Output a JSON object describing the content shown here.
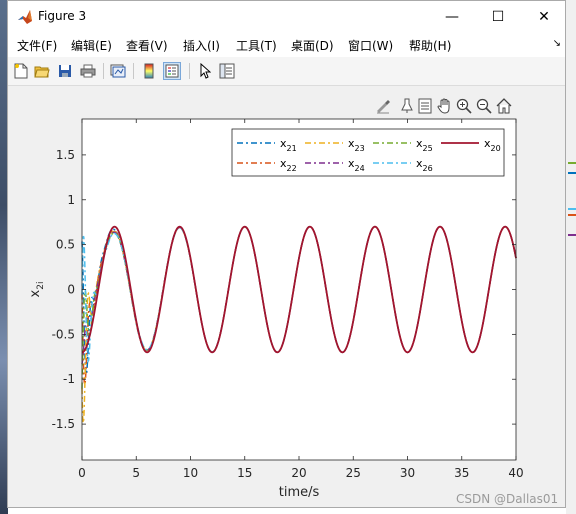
{
  "window": {
    "title": "Figure 3",
    "controls": {
      "minimize": "—",
      "maximize": "☐",
      "close": "✕"
    }
  },
  "menu": {
    "items": [
      "文件(F)",
      "编辑(E)",
      "查看(V)",
      "插入(I)",
      "工具(T)",
      "桌面(D)",
      "窗口(W)",
      "帮助(H)"
    ]
  },
  "toolbar": {
    "icons": [
      "new-figure-icon",
      "open-file-icon",
      "save-icon",
      "print-icon",
      "link-plot-icon",
      "colorbar-icon",
      "legend-icon",
      "edit-plot-arrow-icon",
      "property-inspector-icon"
    ]
  },
  "axes_toolbar": {
    "icons": [
      "brush-data-icon",
      "data-tips-icon",
      "save-export-icon",
      "pan-hand-icon",
      "zoom-in-icon",
      "zoom-out-icon",
      "restore-home-icon"
    ]
  },
  "chart_data": {
    "type": "line",
    "xlabel": "time/s",
    "ylabel": "x",
    "ylabel_sub": "2i",
    "xlim": [
      0,
      40
    ],
    "ylim": [
      -1.9,
      1.9
    ],
    "xticks": [
      "0",
      "5",
      "10",
      "15",
      "20",
      "25",
      "30",
      "35",
      "40"
    ],
    "yticks": [
      "1.5",
      "1",
      "0.5",
      "0",
      "-0.5",
      "-1",
      "-1.5"
    ],
    "grid": false,
    "legend_position": "top-right",
    "reference": {
      "amplitude": 0.7,
      "period": 6.0
    },
    "series": [
      {
        "name": "x",
        "sub": "21",
        "color": "#0072BD",
        "dash": "dashdot",
        "initial": 0.45
      },
      {
        "name": "x",
        "sub": "22",
        "color": "#D95319",
        "dash": "dashdot",
        "initial": 0.3
      },
      {
        "name": "x",
        "sub": "23",
        "color": "#EDB120",
        "dash": "dashdot",
        "initial": 0.6
      },
      {
        "name": "x",
        "sub": "24",
        "color": "#7E2F8E",
        "dash": "dashdot",
        "initial": -0.4
      },
      {
        "name": "x",
        "sub": "25",
        "color": "#77AC30",
        "dash": "dashdot",
        "initial": 0.2
      },
      {
        "name": "x",
        "sub": "26",
        "color": "#4DBEEE",
        "dash": "dashdot",
        "initial": 0.85
      },
      {
        "name": "x",
        "sub": "20",
        "color": "#A2142F",
        "dash": "solid",
        "initial": -0.6
      }
    ]
  },
  "watermark": "CSDN @Dallas01",
  "background_colors": [
    "#77AC30",
    "#0072BD",
    "#4DBEEE",
    "#D95319",
    "#7E2F8E"
  ]
}
